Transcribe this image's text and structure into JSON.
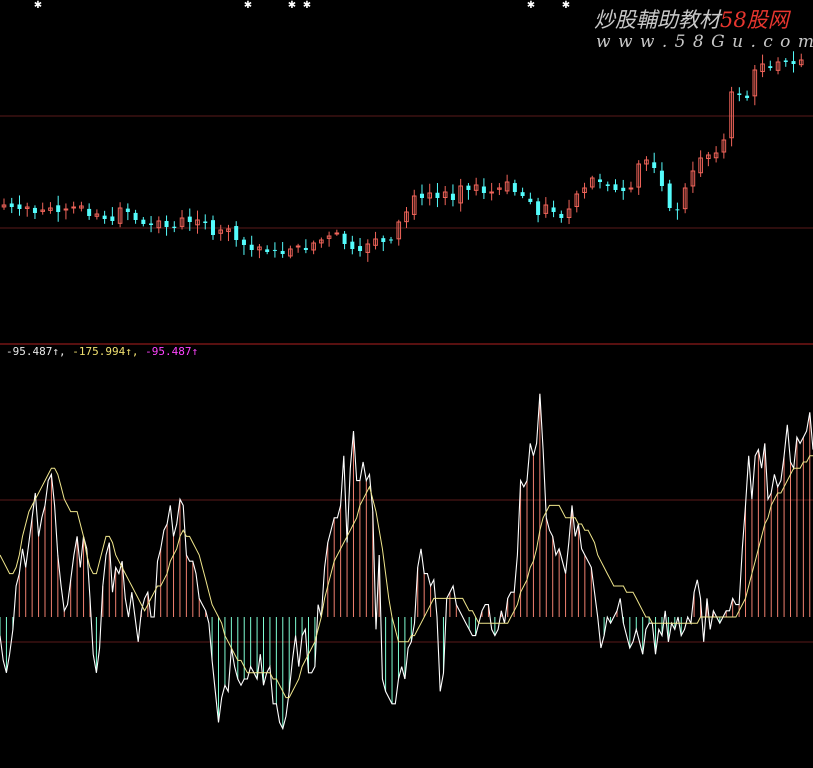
{
  "watermark": {
    "text_prefix": "炒股輔助教材",
    "text_brand": "58股网",
    "url": "w w w . 5 8 G u . c o m"
  },
  "indicator_header": {
    "values": [
      {
        "text": "-95.487↑,",
        "color": "#e8e8e8"
      },
      {
        "text": "-175.994↑,",
        "color": "#f0e070"
      },
      {
        "text": "-95.487↑",
        "color": "#ff44ff"
      }
    ]
  },
  "colors": {
    "background": "#000000",
    "up_candle": "#f0645a",
    "down_candle": "#54fcfc",
    "gridline": "#5a1a1a",
    "separator": "#b02020",
    "osc_line": "#ffffff",
    "signal_line": "#f0e68c",
    "pos_hist": "#f08070",
    "neg_hist": "#7fffd4",
    "marker": "#ffffff"
  },
  "chart_data": [
    {
      "type": "candlestick",
      "title": "",
      "price_closes": [
        205,
        207,
        209,
        207,
        213,
        210,
        208,
        212,
        209,
        207,
        206,
        216,
        214,
        219,
        221,
        208,
        212,
        220,
        224,
        225,
        221,
        227,
        228,
        218,
        222,
        220,
        223,
        235,
        230,
        229,
        240,
        245,
        250,
        247,
        252,
        250,
        254,
        249,
        246,
        250,
        243,
        240,
        236,
        233,
        244,
        249,
        251,
        244,
        239,
        242,
        240,
        222,
        212,
        196,
        198,
        193,
        198,
        192,
        200,
        186,
        190,
        185,
        193,
        192,
        188,
        182,
        192,
        196,
        202,
        215,
        205,
        212,
        218,
        209,
        194,
        188,
        178,
        182,
        186,
        190,
        191,
        188,
        164,
        160,
        168,
        186,
        208,
        210,
        188,
        171,
        158,
        155,
        153,
        140,
        92,
        95,
        98,
        70,
        64,
        68,
        62,
        62,
        64,
        60
      ],
      "marker_rows": {
        "top_markers_x": [
          38,
          248,
          292,
          307,
          531,
          566
        ],
        "top_markers_y": 3
      },
      "xlabel": "",
      "ylabel": ""
    },
    {
      "type": "line",
      "title": "",
      "series": [
        {
          "kind": "histogram_and_line",
          "values": [
            170,
            130,
            110,
            140,
            180,
            250,
            270,
            310,
            280,
            320,
            360,
            400,
            330,
            360,
            380,
            420,
            430,
            380,
            300,
            250,
            210,
            220,
            260,
            300,
            330,
            280,
            330,
            310,
            230,
            140,
            110,
            150,
            250,
            300,
            320,
            240,
            280,
            270,
            290,
            230,
            200,
            240,
            200,
            160,
            210,
            230,
            240,
            200,
            200,
            290,
            310,
            340,
            350,
            380,
            330,
            350,
            390,
            380,
            300,
            290,
            290,
            270,
            230,
            220,
            210,
            190,
            130,
            80,
            30,
            70,
            90,
            80,
            150,
            120,
            100,
            90,
            100,
            100,
            120,
            110,
            100,
            140,
            90,
            110,
            120,
            60,
            60,
            30,
            20,
            40,
            80,
            130,
            170,
            120,
            170,
            180,
            110,
            110,
            120,
            220,
            200,
            280,
            320,
            340,
            360,
            360,
            380,
            460,
            320,
            440,
            500,
            420,
            420,
            450,
            420,
            430,
            370,
            180,
            300,
            100,
            80,
            70,
            60,
            60,
            100,
            120,
            100,
            150,
            160,
            190,
            280,
            310,
            270,
            270,
            250,
            260,
            200,
            80,
            110,
            230,
            240,
            250,
            220,
            210,
            200,
            190,
            180,
            170,
            170,
            190,
            210,
            220,
            220,
            180,
            170,
            180,
            210,
            190,
            230,
            240,
            240,
            300,
            420,
            410,
            420,
            480,
            460,
            480,
            560,
            470,
            360,
            340,
            330,
            300,
            310,
            290,
            270,
            320,
            380,
            330,
            350,
            310,
            300,
            290,
            280,
            240,
            200,
            150,
            170,
            200,
            190,
            200,
            210,
            230,
            190,
            170,
            150,
            160,
            180,
            160,
            140,
            180,
            190,
            190,
            140,
            180,
            170,
            210,
            160,
            190,
            180,
            200,
            170,
            180,
            200,
            190,
            240,
            260,
            230,
            160,
            230,
            180,
            210,
            200,
            190,
            200,
            210,
            210,
            230,
            220,
            220,
            310,
            380,
            460,
            390,
            460,
            470,
            440,
            480,
            390,
            400,
            430,
            410,
            420,
            460,
            510,
            450,
            440,
            490,
            480,
            490,
            500,
            530,
            470
          ]
        },
        {
          "kind": "signal",
          "values": [
            300,
            290,
            280,
            270,
            270,
            280,
            300,
            330,
            350,
            370,
            380,
            390,
            400,
            410,
            420,
            430,
            440,
            440,
            430,
            410,
            390,
            380,
            370,
            370,
            370,
            350,
            330,
            300,
            280,
            270,
            270,
            290,
            310,
            330,
            330,
            320,
            300,
            290,
            280,
            270,
            260,
            250,
            240,
            230,
            220,
            210,
            220,
            230,
            240,
            250,
            250,
            260,
            270,
            290,
            300,
            310,
            330,
            340,
            330,
            330,
            320,
            310,
            300,
            280,
            260,
            240,
            220,
            210,
            200,
            190,
            170,
            160,
            150,
            140,
            130,
            130,
            120,
            110,
            110,
            110,
            110,
            110,
            110,
            110,
            110,
            100,
            100,
            90,
            80,
            70,
            70,
            80,
            90,
            100,
            120,
            130,
            140,
            150,
            160,
            180,
            200,
            230,
            250,
            270,
            290,
            300,
            310,
            320,
            330,
            340,
            350,
            360,
            380,
            390,
            400,
            410,
            390,
            370,
            340,
            310,
            270,
            230,
            200,
            180,
            160,
            160,
            160,
            160,
            170,
            170,
            180,
            190,
            200,
            210,
            220,
            230,
            230,
            230,
            230,
            230,
            230,
            230,
            230,
            230,
            230,
            220,
            210,
            210,
            200,
            190,
            190,
            190,
            190,
            190,
            190,
            190,
            190,
            190,
            190,
            200,
            210,
            220,
            240,
            250,
            260,
            280,
            290,
            310,
            340,
            360,
            370,
            380,
            380,
            380,
            380,
            370,
            360,
            360,
            360,
            360,
            350,
            350,
            340,
            340,
            330,
            320,
            300,
            290,
            280,
            270,
            260,
            250,
            250,
            250,
            250,
            240,
            240,
            240,
            230,
            220,
            210,
            200,
            200,
            190,
            190,
            190,
            190,
            190,
            190,
            190,
            190,
            190,
            190,
            190,
            190,
            190,
            190,
            190,
            200,
            200,
            200,
            200,
            200,
            200,
            200,
            200,
            200,
            200,
            200,
            200,
            210,
            220,
            230,
            250,
            270,
            290,
            310,
            330,
            350,
            360,
            380,
            390,
            400,
            400,
            410,
            420,
            430,
            440,
            440,
            440,
            450,
            450,
            460,
            460
          ]
        }
      ],
      "zero_level": 0,
      "xlabel": "",
      "ylabel": ""
    }
  ]
}
